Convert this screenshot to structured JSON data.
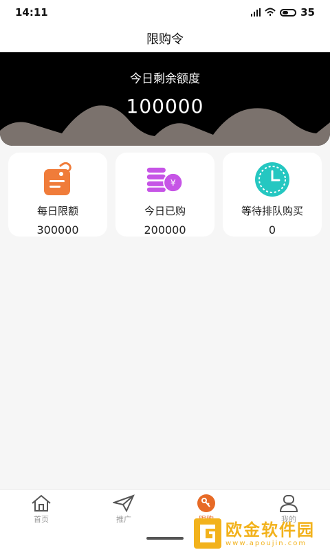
{
  "status_bar": {
    "time": "14:11",
    "battery": "35"
  },
  "header": {
    "title": "限购令"
  },
  "hero": {
    "label": "今日剩余额度",
    "value": "100000"
  },
  "cards": [
    {
      "label": "每日限额",
      "value": "300000",
      "icon": "price-tag-icon",
      "color": "#f07c3a"
    },
    {
      "label": "今日已购",
      "value": "200000",
      "icon": "coins-icon",
      "color": "#c654e6"
    },
    {
      "label": "等待排队购买",
      "value": "0",
      "icon": "clock-icon",
      "color": "#25c7c1"
    }
  ],
  "tabbar": {
    "items": [
      {
        "label": "首页",
        "icon": "home-icon"
      },
      {
        "label": "推广",
        "icon": "paper-plane-icon"
      },
      {
        "label": "限购",
        "icon": "key-icon",
        "active": true
      },
      {
        "label": "我的",
        "icon": "user-icon"
      }
    ]
  },
  "watermark": {
    "main": "欧金软件园",
    "sub": "www.apoujin.com"
  }
}
